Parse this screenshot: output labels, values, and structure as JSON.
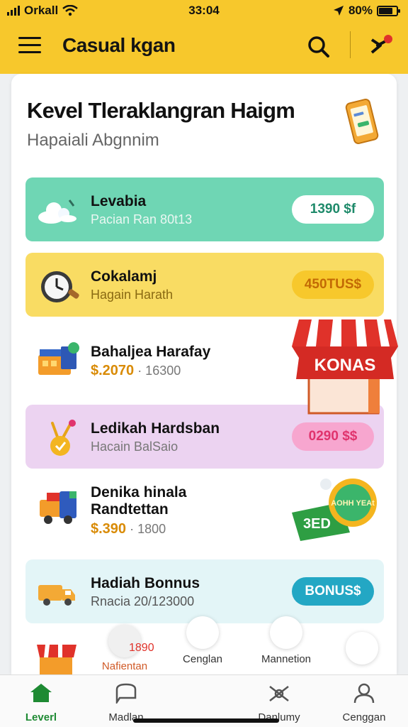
{
  "status_bar": {
    "carrier": "Orkall",
    "time": "33:04",
    "battery": "80%",
    "battery_level": 0.8
  },
  "header": {
    "title": "Casual kgan"
  },
  "main": {
    "title": "Kevel Tleraklangran Haigm",
    "subtitle": "Hapaiali Abgnnim",
    "rows": [
      {
        "title": "Levabia",
        "subtitle": "Pacian Ran 80t13",
        "pill": "1390 $f",
        "color": "#6fd6b4",
        "pill_color": "#1e8a6a"
      },
      {
        "title": "Cokalamj",
        "subtitle": "Hagain Harath",
        "pill": "450TUS$",
        "color": "#f9dc63",
        "pill_color": "#c36a05"
      },
      {
        "title": "Bahaljea Harafay",
        "price": "$.2070",
        "price_old": "· 16300"
      },
      {
        "title": "Ledikah Hardsban",
        "subtitle": "Hacain BalSaio",
        "pill": "0290 $$",
        "color": "#ecd3f1",
        "pill_color": "#e0336d"
      },
      {
        "title": "Denika hinala",
        "title2": "Randtettan",
        "price": "$.390",
        "price_old": "· 1800"
      },
      {
        "title": "Hadiah Bonnus",
        "subtitle": "Rnacia 20/123000",
        "pill": "BONUS$",
        "color": "#e3f5f7",
        "pill_color": "#ffffff"
      }
    ]
  },
  "badges": {
    "shop": "KONAS",
    "coin": "3ED",
    "coin_text": "AOHH YEAt"
  },
  "dock": {
    "item1_label": "Nafientan",
    "item1_value": "1890",
    "item2_label": "Cenglan",
    "item3_label": "Mannetion"
  },
  "bottom_nav": {
    "items": [
      {
        "label": "Leverl"
      },
      {
        "label": "Madlan"
      },
      {
        "label": "Danlumy"
      },
      {
        "label": "Cenggan"
      }
    ]
  },
  "colors": {
    "accent": "#f7c82c",
    "nav_active": "#1e8a33"
  }
}
